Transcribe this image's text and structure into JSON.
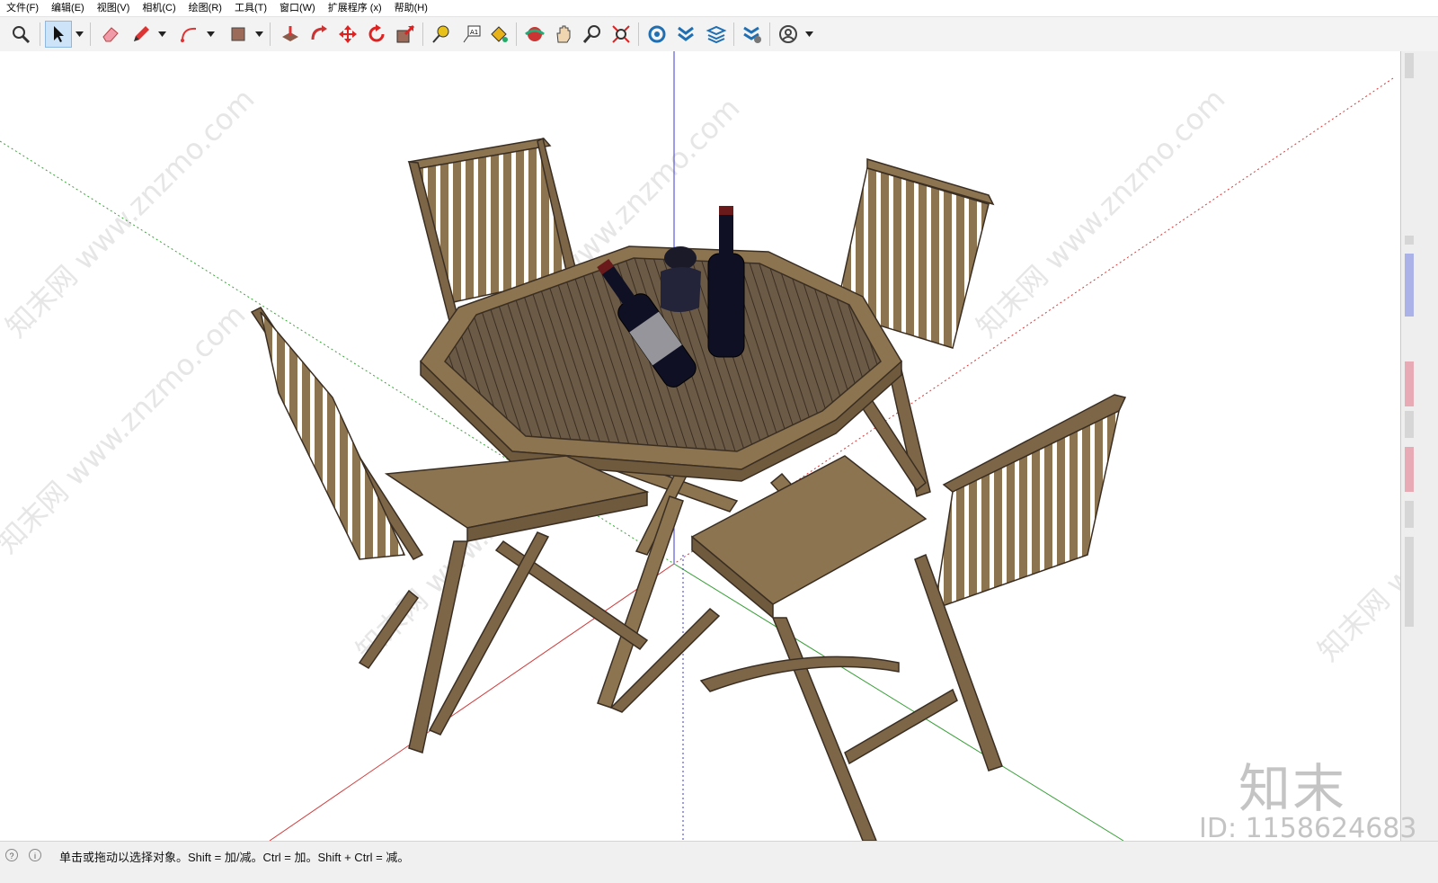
{
  "menu": {
    "items": [
      "文件(F)",
      "编辑(E)",
      "视图(V)",
      "相机(C)",
      "绘图(R)",
      "工具(T)",
      "窗口(W)",
      "扩展程序 (x)",
      "帮助(H)"
    ]
  },
  "toolbar": {
    "tools": [
      {
        "name": "zoom-icon"
      },
      {
        "name": "select-arrow-icon",
        "active": true
      },
      {
        "name": "eraser-icon"
      },
      {
        "name": "pencil-line-icon"
      },
      {
        "name": "arc-icon"
      },
      {
        "name": "rectangle-shape-icon"
      },
      {
        "name": "push-pull-icon"
      },
      {
        "name": "follow-me-icon"
      },
      {
        "name": "move-icon"
      },
      {
        "name": "rotate-icon"
      },
      {
        "name": "scale-icon"
      },
      {
        "name": "tape-measure-icon"
      },
      {
        "name": "text-label-icon"
      },
      {
        "name": "paint-bucket-icon"
      },
      {
        "name": "orbit-icon"
      },
      {
        "name": "pan-icon"
      },
      {
        "name": "zoom-window-icon"
      },
      {
        "name": "zoom-extents-icon"
      },
      {
        "name": "warehouse-icon"
      },
      {
        "name": "extension-warehouse-icon"
      },
      {
        "name": "layout-send-icon"
      },
      {
        "name": "extension-manager-icon"
      },
      {
        "name": "account-icon"
      }
    ]
  },
  "viewport": {
    "watermark": "知末网 www.znzmo.com",
    "axis_colors": {
      "blue": "#3a3ad0",
      "red": "#d23a3a",
      "green": "#3aa03a"
    },
    "wood_color": "#8c7450",
    "table_top_color": "#6b5a45"
  },
  "branding": {
    "logo": "知末",
    "asset_id": "ID: 1158624683"
  },
  "statusbar": {
    "icon_1": "?",
    "icon_2": "i",
    "text": "单击或拖动以选择对象。Shift = 加/减。Ctrl = 加。Shift + Ctrl = 减。"
  }
}
